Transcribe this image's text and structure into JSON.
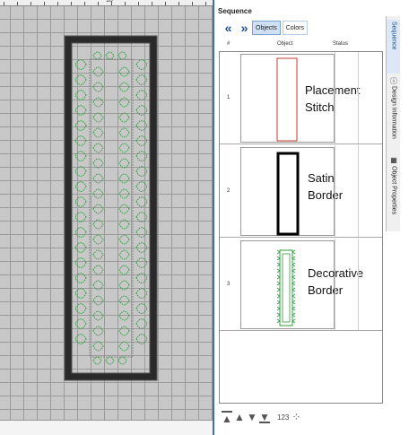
{
  "ruler": {
    "label": "10"
  },
  "panel": {
    "title": "Sequence",
    "nav": {
      "back": "«",
      "forward": "»"
    },
    "tabs": [
      "Objects",
      "Colors"
    ],
    "columns": {
      "num": "#",
      "object": "Object",
      "status": "Status"
    },
    "rows": [
      {
        "num": "1",
        "label_line1": "Placement",
        "label_line2": "Stitch"
      },
      {
        "num": "2",
        "label_line1": "Satin",
        "label_line2": "Border"
      },
      {
        "num": "3",
        "label_line1": "Decorative",
        "label_line2": "Border"
      }
    ],
    "bottom": {
      "move_first": "▲",
      "move_up": "▲",
      "move_down": "▼",
      "move_last": "▼",
      "resequence": "123"
    }
  },
  "side_tabs": [
    "Sequence",
    "Design Information",
    "Object Properties"
  ],
  "colors": {
    "grid_bg": "#c8c8c8",
    "border_dark": "#2a2a2a",
    "stitch_green": "#2e9e3e",
    "placement_red": "#c0392b",
    "accent": "#3c6fb0"
  }
}
